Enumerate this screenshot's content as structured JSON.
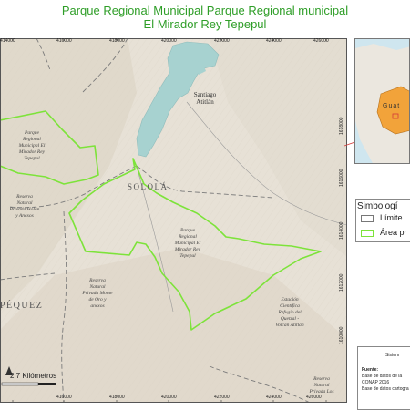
{
  "title": {
    "line1": "Parque Regional Municipal Parque Regional municipal",
    "line2": "El Mirador Rey Tepepul"
  },
  "colors": {
    "title": "#2f9e28",
    "protected_area_outline": "#7de33a",
    "lake": "#a7d2d0",
    "terrain": "#e7e1d6",
    "inset_country_highlight": "#f2a33a",
    "inset_locator_line": "#d23a3a"
  },
  "grid": {
    "x_ticks": [
      "414000",
      "416000",
      "418000",
      "420000",
      "422000",
      "424000",
      "426000"
    ],
    "y_ticks": [
      "1618000",
      "1616000",
      "1614000",
      "1612000",
      "1610000"
    ]
  },
  "places": {
    "lake_town": "Santiago\nAtitlán",
    "department": "SOLOLÁ",
    "department_partial": "PÉQUEZ"
  },
  "protected_areas": {
    "park_north_label": "Parque\nRegional\nMunicipal El\nMirador Rey\nTepepul",
    "park_south_label": "Parque\nRegional\nMunicipal El\nMirador Rey\nTepepul",
    "reserve_1": "Reserva\nNatural\nPrivada Holán\ny Anexos",
    "reserve_2": "Reserva\nNatural\nPrivada Monte\nde Oro y\nanexos",
    "station": "Estación\nCientífica\nRefugio del\nQuetzal -\nVolcán Atitlán",
    "reserve_bottom": "Reserva\nNatural\nPrivada Los"
  },
  "scale_bar": {
    "label": "2.7 Kilómetros"
  },
  "legend": {
    "title": "Simbologí",
    "items": [
      {
        "label": "Límite",
        "type": "boundary"
      },
      {
        "label": "Área pr",
        "type": "protected_area"
      }
    ]
  },
  "inset": {
    "label": "Guat",
    "highlight": "#f2a33a"
  },
  "info": {
    "heading": "Sistem",
    "source_label": "Fuente:",
    "source_line1": "Base de datos de la",
    "source_line2": "CONAP 2016",
    "source_line3": "Base de datos cartogra"
  }
}
